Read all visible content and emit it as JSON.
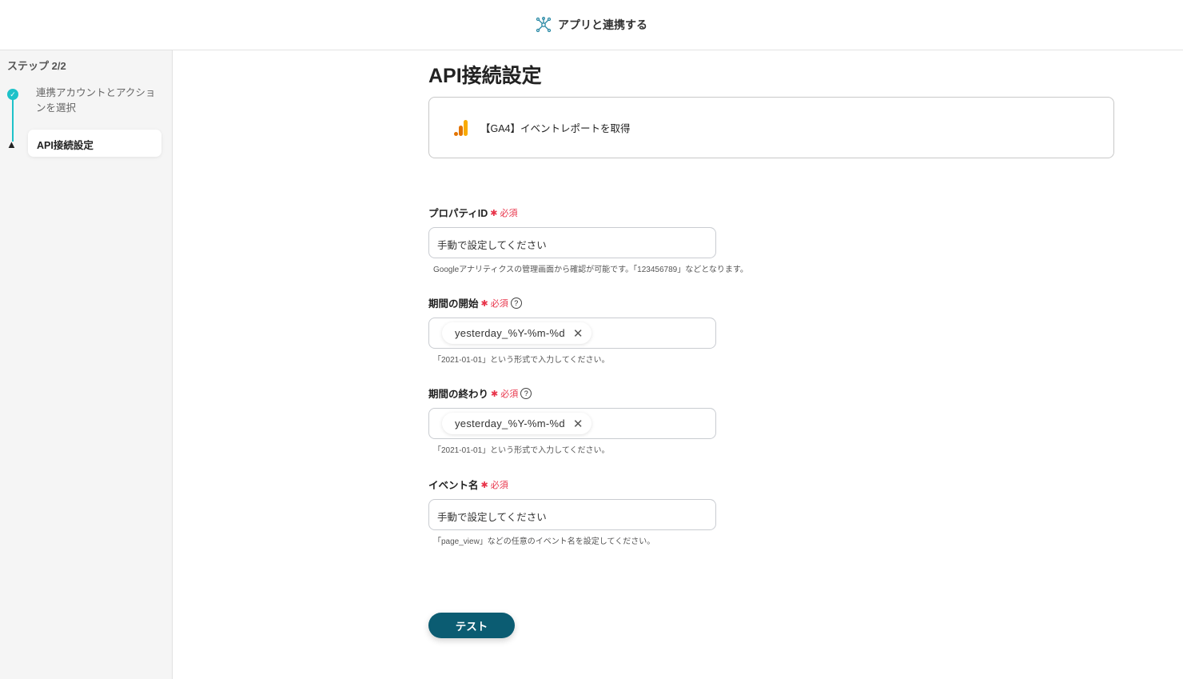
{
  "header": {
    "title": "アプリと連携する",
    "icon": "network-icon"
  },
  "sidebar": {
    "step_label": "ステップ 2/2",
    "steps": [
      {
        "label": "連携アカウントとアクションを選択",
        "status": "complete"
      },
      {
        "label": "API接続設定",
        "status": "current"
      }
    ]
  },
  "main": {
    "title": "API接続設定",
    "action_card": {
      "label": "【GA4】イベントレポートを取得"
    },
    "required": "必須",
    "fields": [
      {
        "label": "プロパティID",
        "value": "手動で設定してください",
        "hint": "Googleアナリティクスの管理画面から確認が可能です。「123456789」などとなります。"
      },
      {
        "label": "期間の開始",
        "chip": "yesterday_%Y-%m-%d",
        "hint": "「2021-01-01」という形式で入力してください。"
      },
      {
        "label": "期間の終わり",
        "chip": "yesterday_%Y-%m-%d",
        "hint": "「2021-01-01」という形式で入力してください。"
      },
      {
        "label": "イベント名",
        "value": "手動で設定してください",
        "hint": "「page_view」などの任意のイベント名を設定してください。"
      }
    ],
    "test_button": "テスト"
  },
  "colors": {
    "accent": "#1ec2c9",
    "button": "#0b5c72",
    "required": "#e8344a",
    "ga_orange": "#f57c00"
  }
}
